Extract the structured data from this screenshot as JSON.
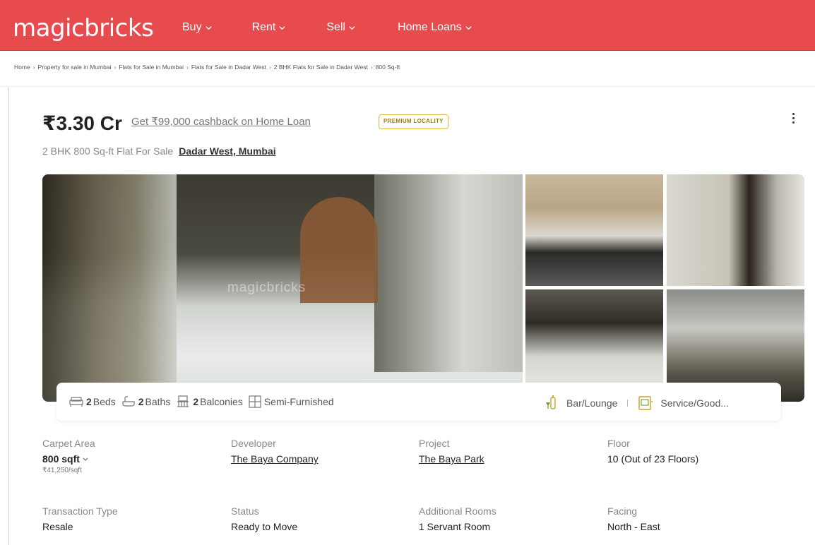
{
  "header": {
    "logo": "magicbricks",
    "nav": [
      "Buy",
      "Rent",
      "Sell",
      "Home Loans"
    ],
    "brand_color": "#e74b4e"
  },
  "breadcrumb": [
    "Home",
    "Property for sale in Mumbai",
    "Flats for Sale in Mumbai",
    "Flats for Sale in Dadar West",
    "2 BHK Flats for Sale in Dadar West",
    "800 Sq-ft"
  ],
  "listing": {
    "price": "₹3.30 Cr",
    "cashback": "Get ₹99,000 cashback on Home Loan",
    "badge": "PREMIUM LOCALITY",
    "subtitle": "2 BHK 800 Sq-ft Flat For Sale",
    "location": "Dadar West, Mumbai",
    "watermark": "magicbricks"
  },
  "amenities": {
    "beds_count": "2",
    "beds_label": "Beds",
    "baths_count": "2",
    "baths_label": "Baths",
    "balconies_count": "2",
    "balconies_label": "Balconies",
    "furnishing": "Semi-Furnished",
    "extra1": "Bar/Lounge",
    "extra2": "Service/Good..."
  },
  "details": {
    "carpet_area_label": "Carpet Area",
    "carpet_area_value": "800 sqft",
    "carpet_area_rate": "₹41,250/sqft",
    "developer_label": "Developer",
    "developer_value": "The Baya Company",
    "project_label": "Project",
    "project_value": "The Baya Park",
    "floor_label": "Floor",
    "floor_value": "10 (Out of 23 Floors)",
    "transaction_label": "Transaction Type",
    "transaction_value": "Resale",
    "status_label": "Status",
    "status_value": "Ready to Move",
    "rooms_label": "Additional Rooms",
    "rooms_value": "1 Servant Room",
    "facing_label": "Facing",
    "facing_value": "North - East"
  }
}
